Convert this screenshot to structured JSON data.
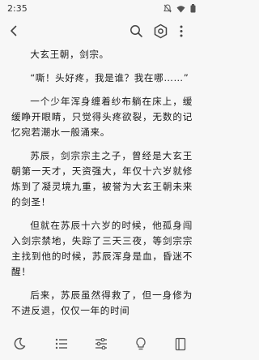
{
  "status_bar": {
    "time": "2:35",
    "icons": [
      "mute-icon",
      "wifi-icon",
      "battery-icon"
    ]
  },
  "toolbar": {
    "icons": [
      "back-icon",
      "search-icon",
      "settings-icon",
      "more-icon"
    ]
  },
  "content": {
    "paragraphs": [
      "大玄王朝，剑宗。",
      "“嘶！头好疼，我是谁？我在哪……”",
      "一个少年浑身缠着纱布躺在床上，缓缓睁开眼睛，只觉得头疼欲裂，无数的记忆宛若潮水一般涌来。",
      "苏辰，剑宗宗主之子，曾经是大玄王朝第一天才，天资强大，年仅十六岁就修炼到了凝灵境九重，被誉为大玄王朝未来的剑圣！",
      "但就在苏辰十六岁的时候，他孤身闯入剑宗禁地，失踪了三天三夜，等剑宗宗主找到他的时候，苏辰浑身是血，昏迷不醒！",
      "后来，苏辰虽然得救了，但一身修为不进反退，仅仅一年的时间"
    ]
  },
  "bottom_bar": {
    "icons": [
      "night-mode-icon",
      "chapters-icon",
      "adjust-icon",
      "bulb-icon",
      "bookmark-icon"
    ]
  },
  "colors": {
    "background": "#f7f7f7",
    "text": "#1a1a1a",
    "icon": "#555555"
  }
}
